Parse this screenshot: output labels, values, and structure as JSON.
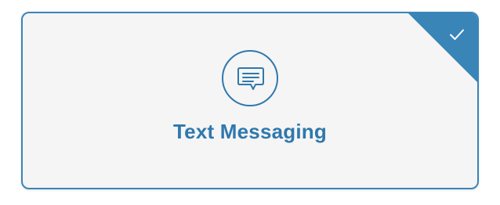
{
  "option": {
    "title": "Text Messaging",
    "icon": "chat-bubble-icon",
    "selected_icon": "checkmark-icon",
    "selected": true
  },
  "colors": {
    "accent": "#3a85b8",
    "text": "#2f78ad",
    "card_background": "#f5f5f5"
  }
}
